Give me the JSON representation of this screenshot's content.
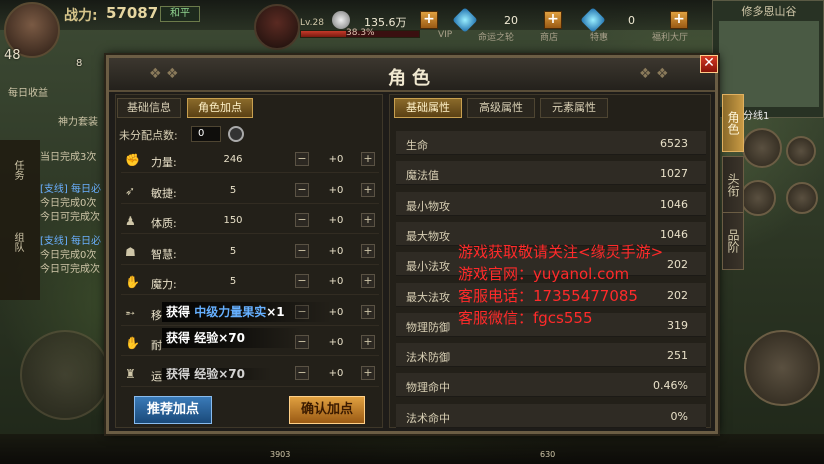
{
  "hud": {
    "power_label": "战力:",
    "power_value": "57087",
    "mode_label": "和平",
    "player_level": "48",
    "player_level_sub": "8",
    "daily_label": "每日收益",
    "target_level": "Lv.28",
    "target_hp_pct": 0.383,
    "target_hp_text": "38.3%",
    "currencies": [
      {
        "value": "135.6万",
        "label": "VIP"
      },
      {
        "value": "20",
        "label": "命运之轮"
      },
      {
        "value": "0",
        "label": "福利大厅"
      }
    ],
    "shop_label": "商店",
    "special_label": "特惠",
    "map_name": "修多恩山谷",
    "map_line": "分线1",
    "left_texts": [
      "神力套装",
      "任务",
      "组队",
      "当日完成3次",
      "[支线] 每日必",
      "今日完成0次",
      "今日可完成次",
      "[支线] 每日必",
      "今日完成0次",
      "今日可完成次"
    ],
    "bottom_left_value": "3903",
    "bottom_right_value": "630"
  },
  "dialog": {
    "title": "角色",
    "close_label": "✕",
    "side_tabs": [
      {
        "label": "角色",
        "active": true
      },
      {
        "label": "头衔",
        "active": false
      },
      {
        "label": "品阶",
        "active": false
      }
    ],
    "left_tabs": [
      {
        "label": "基础信息",
        "active": false
      },
      {
        "label": "角色加点",
        "active": true
      }
    ],
    "unassigned_label": "未分配点数:",
    "unassigned_value": "0",
    "attributes": [
      {
        "icon": "fist",
        "name": "力量:",
        "value": "246",
        "add": "+0"
      },
      {
        "icon": "run",
        "name": "敏捷:",
        "value": "5",
        "add": "+0"
      },
      {
        "icon": "body",
        "name": "体质:",
        "value": "150",
        "add": "+0"
      },
      {
        "icon": "head",
        "name": "智慧:",
        "value": "5",
        "add": "+0"
      },
      {
        "icon": "hand",
        "name": "魔力:",
        "value": "5",
        "add": "+0"
      },
      {
        "icon": "move",
        "name": "移",
        "value": "",
        "add": "+0"
      },
      {
        "icon": "endure",
        "name": "耐",
        "value": "",
        "add": "+0"
      },
      {
        "icon": "luck",
        "name": "运",
        "value": "",
        "add": "+0"
      }
    ],
    "toasts": [
      {
        "prefix": "获得",
        "item": "中级力量果实",
        "suffix": "×1"
      },
      {
        "prefix": "获得",
        "item": "经验",
        "suffix": "×70"
      },
      {
        "prefix": "获得",
        "item": "经验",
        "suffix": "×70"
      }
    ],
    "recommend_label": "推荐加点",
    "confirm_label": "确认加点",
    "right_tabs": [
      {
        "label": "基础属性",
        "active": true
      },
      {
        "label": "高级属性",
        "active": false
      },
      {
        "label": "元素属性",
        "active": false
      }
    ],
    "stats": [
      {
        "name": "生命",
        "value": "6523"
      },
      {
        "name": "魔法值",
        "value": "1027"
      },
      {
        "name": "最小物攻",
        "value": "1046"
      },
      {
        "name": "最大物攻",
        "value": "1046"
      },
      {
        "name": "最小法攻",
        "value": "202"
      },
      {
        "name": "最大法攻",
        "value": "202"
      },
      {
        "name": "物理防御",
        "value": "319"
      },
      {
        "name": "法术防御",
        "value": "251"
      },
      {
        "name": "物理命中",
        "value": "0.46%"
      },
      {
        "name": "法术命中",
        "value": "0%"
      }
    ]
  },
  "watermark": [
    "游戏获取敬请关注<缘灵手游>",
    "游戏官网：yuyanol.com",
    "客服电话：17355477085",
    "客服微信：fgcs555"
  ]
}
